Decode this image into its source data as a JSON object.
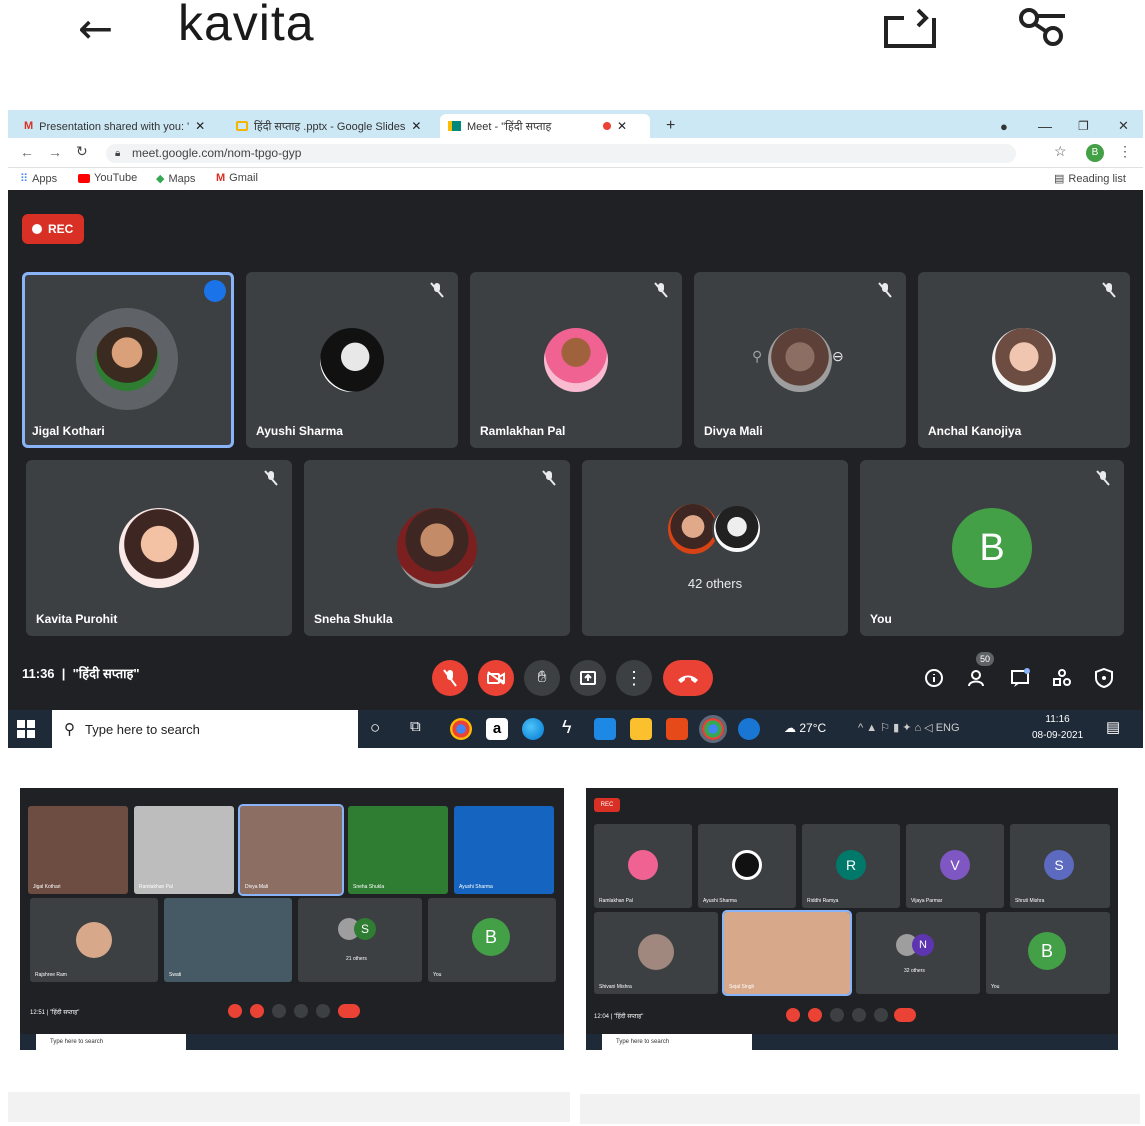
{
  "appbar": {
    "title": "kavita"
  },
  "browser": {
    "tabs": [
      {
        "label": "Presentation shared with you: \"ि",
        "icon": "gmail-icon"
      },
      {
        "label": "हिंदी सप्ताह .pptx - Google Slides",
        "icon": "slides-icon"
      },
      {
        "label": "Meet - \"हिंदी सप्ताह",
        "icon": "meet-icon"
      }
    ],
    "url": "meet.google.com/nom-tpgo-gyp",
    "profile_initial": "B",
    "bookmarks": [
      "Apps",
      "YouTube",
      "Maps",
      "Gmail"
    ],
    "reading_list": "Reading list"
  },
  "meet": {
    "rec_label": "REC",
    "tiles_row1": [
      {
        "name": "Jigal Kothari",
        "speaking": true
      },
      {
        "name": "Ayushi Sharma",
        "speaking": false
      },
      {
        "name": "Ramlakhan Pal",
        "speaking": false
      },
      {
        "name": "Divya Mali",
        "speaking": false
      },
      {
        "name": "Anchal Kanojiya",
        "speaking": false
      }
    ],
    "tiles_row2": [
      {
        "name": "Kavita Purohit"
      },
      {
        "name": "Sneha Shukla"
      },
      {
        "name": "",
        "others": "42 others"
      },
      {
        "name": "You",
        "initial": "B"
      }
    ],
    "meeting_time": "11:36",
    "meeting_title": "\"हिंदी सप्ताह\"",
    "participants_count": "50"
  },
  "taskbar": {
    "search_placeholder": "Type here to search",
    "weather": "27°C",
    "lang": "ENG",
    "time": "11:16",
    "date": "08-09-2021"
  },
  "thumb_left": {
    "tiles": [
      "Jigal Kothari",
      "Ramlakhan Pal",
      "Divya Mali",
      "Sneha Shukla",
      "Ayushi Sharma",
      "Rajshree Ram",
      "Swati",
      "21 others",
      "You"
    ],
    "others_initial": "S",
    "you_initial": "B",
    "time": "12:51",
    "title": "\"हिंदी सप्ताह\"",
    "search": "Type here to search"
  },
  "thumb_right": {
    "rec_label": "REC",
    "tiles": [
      "Ramlakhan Pal",
      "Ayushi Sharma",
      "Riddhi Ramya",
      "Vijaya Parmar",
      "Shruti Mishra",
      "Shivani Mishra",
      "Sejal Singh",
      "32 others",
      "You"
    ],
    "initials": [
      "R",
      "V",
      "S",
      "N",
      "B"
    ],
    "time": "12:04",
    "title": "\"हिंदी सप्ताह\"",
    "search": "Type here to search"
  },
  "colors": {
    "accent": "#1a73e8",
    "danger": "#ea4335",
    "tile": "#3c4043",
    "bg": "#202124",
    "you_avatar": "#43a047"
  }
}
